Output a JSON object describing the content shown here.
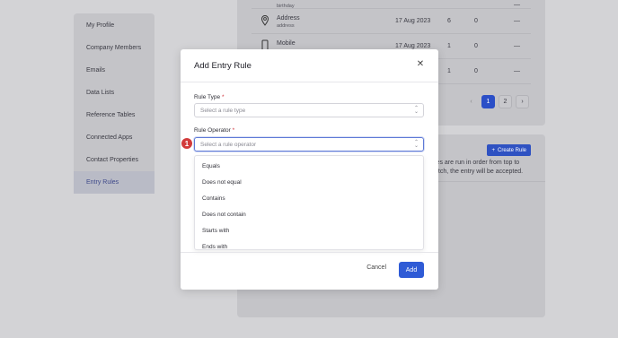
{
  "sidebar": {
    "items": [
      {
        "label": "My Profile"
      },
      {
        "label": "Company Members"
      },
      {
        "label": "Emails"
      },
      {
        "label": "Data Lists"
      },
      {
        "label": "Reference Tables"
      },
      {
        "label": "Connected Apps"
      },
      {
        "label": "Contact Properties"
      },
      {
        "label": "Entry Rules"
      }
    ]
  },
  "table": {
    "rows": [
      {
        "name": "",
        "sub": "birthday",
        "date": "",
        "count": "",
        "zero": "",
        "action": "—"
      },
      {
        "name": "Address",
        "sub": "address",
        "date": "17 Aug 2023",
        "count": "6",
        "zero": "0",
        "action": "—"
      },
      {
        "name": "Mobile",
        "sub": "",
        "date": "17 Aug 2023",
        "count": "1",
        "zero": "0",
        "action": "—"
      },
      {
        "name": "",
        "sub": "",
        "date": "",
        "count": "1",
        "zero": "0",
        "action": "—"
      }
    ]
  },
  "pagination": {
    "prev": "‹",
    "pages": [
      "1",
      "2"
    ],
    "next": "›"
  },
  "rules_card": {
    "create_button": "Create Rule",
    "info_line1": "les are run in order from top to",
    "info_line2": "atch, the entry will be accepted."
  },
  "modal": {
    "title": "Add Entry Rule",
    "rule_type_label": "Rule Type",
    "rule_type_placeholder": "Select a rule type",
    "rule_operator_label": "Rule Operator",
    "rule_operator_placeholder": "Select a rule operator",
    "required_mark": "*",
    "step_badge": "1",
    "options": [
      "Equals",
      "Does not equal",
      "Contains",
      "Does not contain",
      "Starts with",
      "Ends with"
    ],
    "cancel": "Cancel",
    "add": "Add"
  },
  "colors": {
    "accent": "#2f5bd6",
    "badge": "#d23b3b"
  }
}
